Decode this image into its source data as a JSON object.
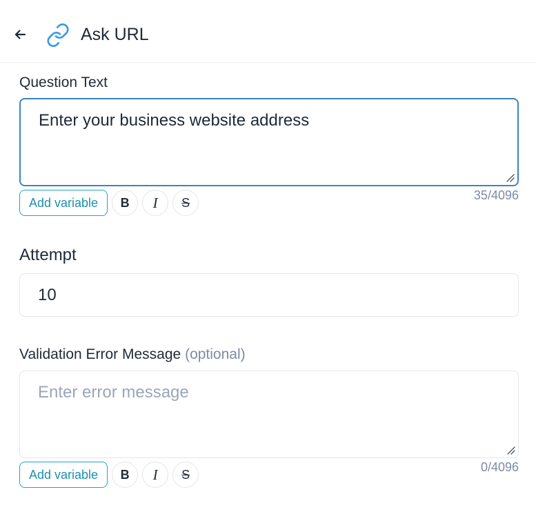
{
  "header": {
    "back_icon": "arrow-left-icon",
    "link_icon": "link-icon",
    "title": "Ask URL",
    "accent": "#3b9be8"
  },
  "question": {
    "label": "Question Text",
    "value": "Enter your business website address",
    "counter": "35/4096",
    "add_variable_label": "Add variable",
    "bold_label": "B",
    "italic_label": "I",
    "strike_label": "S"
  },
  "attempt": {
    "label": "Attempt",
    "value": "10"
  },
  "validation": {
    "label": "Validation Error Message",
    "optional": "(optional)",
    "placeholder": "Enter error message",
    "counter": "0/4096",
    "add_variable_label": "Add variable",
    "bold_label": "B",
    "italic_label": "I",
    "strike_label": "S"
  },
  "colors": {
    "focus_border": "#3b82c4",
    "add_variable": "#1ea4c3",
    "muted_text": "#7b8ba6"
  }
}
